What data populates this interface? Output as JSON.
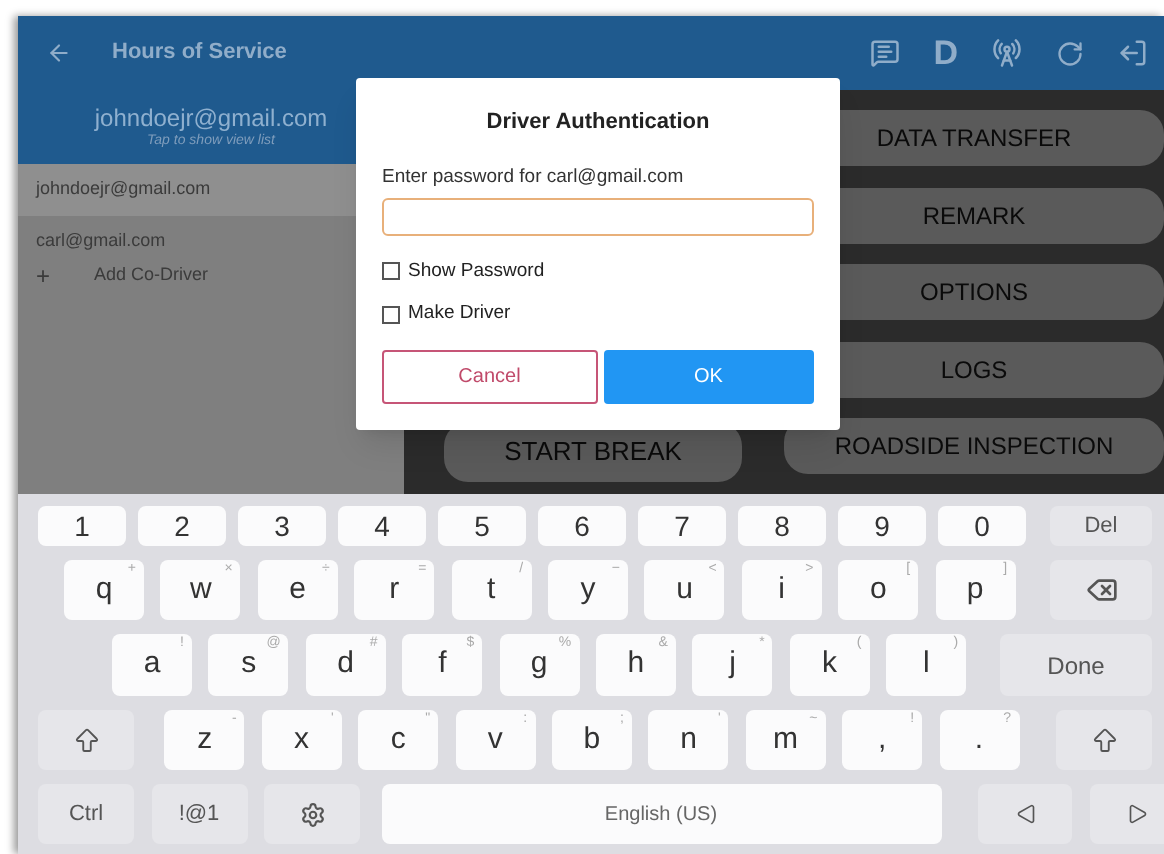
{
  "app_bar": {
    "title": "Hours of Service",
    "status_letter": "D"
  },
  "sidebar": {
    "current_account": {
      "email": "johndoejr@gmail.com",
      "hint": "Tap to show view list"
    },
    "accounts": [
      {
        "email": "johndoejr@gmail.com",
        "selected": true
      },
      {
        "email": "carl@gmail.com",
        "selected": false
      }
    ],
    "add_co_driver": {
      "icon": "+",
      "label": "Add Co-Driver"
    }
  },
  "actions": {
    "left_column": [
      "START BREAK"
    ],
    "right_column": [
      "DATA TRANSFER",
      "REMARK",
      "OPTIONS",
      "LOGS",
      "ROADSIDE INSPECTION"
    ]
  },
  "dialog": {
    "title": "Driver Authentication",
    "prompt": "Enter password for carl@gmail.com",
    "options": [
      {
        "label": "Show Password",
        "checked": false
      },
      {
        "label": "Make Driver",
        "checked": false
      }
    ],
    "buttons": [
      {
        "kind": "cancel",
        "label": "Cancel"
      },
      {
        "kind": "ok",
        "label": "OK"
      }
    ]
  },
  "keyboard": {
    "number_row": [
      {
        "kind": "num",
        "label": "1"
      },
      {
        "kind": "num",
        "label": "2"
      },
      {
        "kind": "num",
        "label": "3"
      },
      {
        "kind": "num",
        "label": "4"
      },
      {
        "kind": "num",
        "label": "5"
      },
      {
        "kind": "num",
        "label": "6"
      },
      {
        "kind": "num",
        "label": "7"
      },
      {
        "kind": "num",
        "label": "8"
      },
      {
        "kind": "num",
        "label": "9"
      },
      {
        "kind": "num",
        "label": "0"
      },
      {
        "kind": "del",
        "label": "Del"
      }
    ],
    "top_letter_row": [
      {
        "kind": "char",
        "label": "q",
        "hint": "+"
      },
      {
        "kind": "char",
        "label": "w",
        "hint": "×"
      },
      {
        "kind": "char",
        "label": "e",
        "hint": "÷"
      },
      {
        "kind": "char",
        "label": "r",
        "hint": "="
      },
      {
        "kind": "char",
        "label": "t",
        "hint": "/"
      },
      {
        "kind": "char",
        "label": "y",
        "hint": "−"
      },
      {
        "kind": "char",
        "label": "u",
        "hint": "<"
      },
      {
        "kind": "char",
        "label": "i",
        "hint": ">"
      },
      {
        "kind": "char",
        "label": "o",
        "hint": "["
      },
      {
        "kind": "char",
        "label": "p",
        "hint": "]"
      },
      {
        "kind": "backspace"
      }
    ],
    "home_letter_row": [
      {
        "kind": "char",
        "label": "a",
        "hint": "!"
      },
      {
        "kind": "char",
        "label": "s",
        "hint": "@"
      },
      {
        "kind": "char",
        "label": "d",
        "hint": "#"
      },
      {
        "kind": "char",
        "label": "f",
        "hint": "$"
      },
      {
        "kind": "char",
        "label": "g",
        "hint": "%"
      },
      {
        "kind": "char",
        "label": "h",
        "hint": "&"
      },
      {
        "kind": "char",
        "label": "j",
        "hint": "*"
      },
      {
        "kind": "char",
        "label": "k",
        "hint": "("
      },
      {
        "kind": "char",
        "label": "l",
        "hint": ")"
      },
      {
        "kind": "done",
        "label": "Done"
      }
    ],
    "bottom_letter_row": [
      {
        "kind": "shift"
      },
      {
        "kind": "char",
        "label": "z",
        "hint": "-"
      },
      {
        "kind": "char",
        "label": "x",
        "hint": "'"
      },
      {
        "kind": "char",
        "label": "c",
        "hint": "\""
      },
      {
        "kind": "char",
        "label": "v",
        "hint": ":"
      },
      {
        "kind": "char",
        "label": "b",
        "hint": ";"
      },
      {
        "kind": "char",
        "label": "n",
        "hint": "'"
      },
      {
        "kind": "char",
        "label": "m",
        "hint": "~"
      },
      {
        "kind": "char",
        "label": ",",
        "hint": "!"
      },
      {
        "kind": "char",
        "label": ".",
        "hint": "?"
      },
      {
        "kind": "shift"
      }
    ],
    "function_row": [
      {
        "kind": "ctrl",
        "label": "Ctrl"
      },
      {
        "kind": "symbols",
        "label": "!@1"
      },
      {
        "kind": "settings"
      },
      {
        "kind": "space",
        "label": "English (US)"
      },
      {
        "kind": "left"
      },
      {
        "kind": "right"
      }
    ]
  }
}
